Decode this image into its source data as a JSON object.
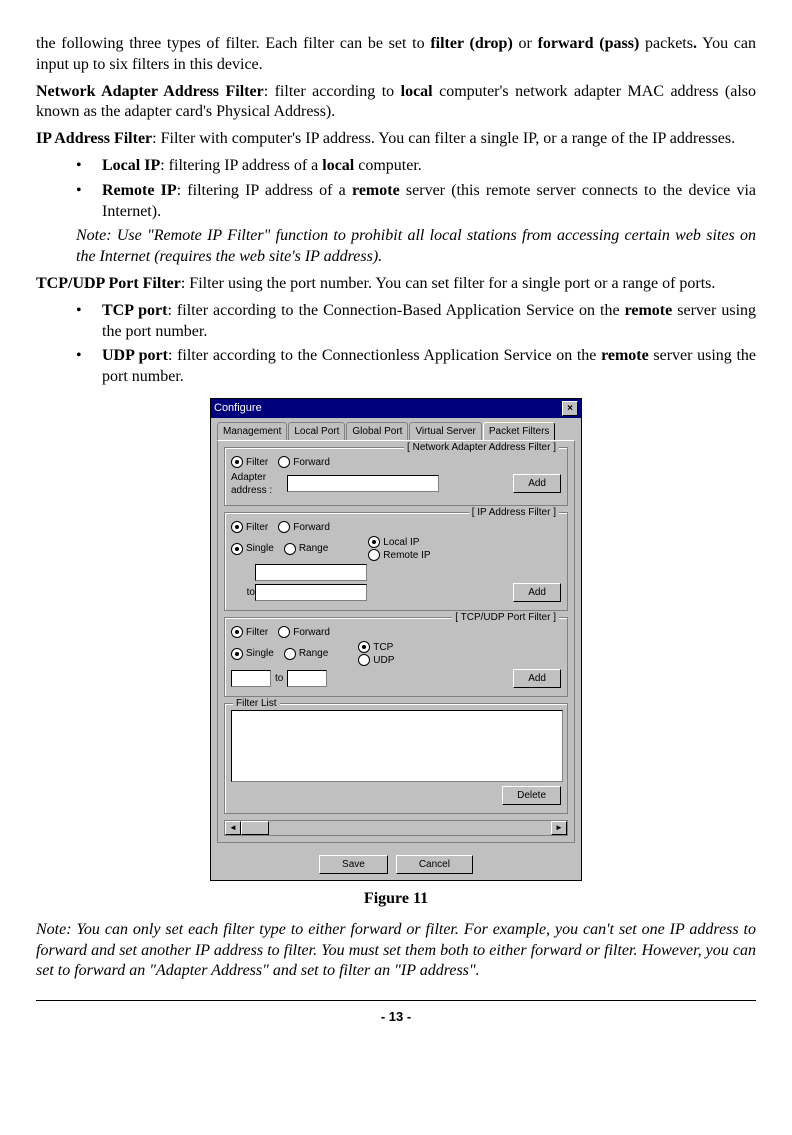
{
  "para_intro": "the following three types of filter. Each filter can be set to ",
  "intro_bold1": "filter (drop)",
  "intro_mid": " or ",
  "intro_bold2": "forward (pass)",
  "intro_end": " packets",
  "intro_tail": ".  You can input up to six filters in this device.",
  "naf_head": "Network Adapter Address Filter",
  "naf_body1": ": filter according to ",
  "naf_bold": "local",
  "naf_body2": " computer's network adapter MAC address (also known as the adapter card's Physical Address).",
  "ipf_head": "IP Address Filter",
  "ipf_body": ": Filter with computer's IP address. You can filter a single IP, or a range of the IP addresses.",
  "li1_head": "Local IP",
  "li1_body1": ": filtering IP address of a ",
  "li1_bold": "local",
  "li1_body2": " computer.",
  "li2_head": "Remote IP",
  "li2_body1": ": filtering IP address of a ",
  "li2_bold": "remote",
  "li2_body2": " server (this remote server connects to the device via Internet).",
  "note1": "Note: Use \"Remote IP Filter\" function to prohibit all local stations from accessing certain web sites on the Internet (requires the web site's IP address).",
  "tpf_head": "TCP/UDP Port Filter",
  "tpf_body": ": Filter using the port number. You can set filter for a single port or a range of ports.",
  "li3_head": "TCP port",
  "li3_body1": ": filter according to the Connection-Based Application Service on the ",
  "li3_bold": "remote",
  "li3_body2": " server using the port number.",
  "li4_head": "UDP port",
  "li4_body1": ": filter according to the Connectionless Application Service on the ",
  "li4_bold": "remote",
  "li4_body2": " server using the port number.",
  "figure_label": "Figure 11",
  "note2": "Note: You can only set each filter type to either forward or filter. For example, you can't set one IP address to forward and set another IP address to filter. You must set them both to either forward or filter. However, you can set to forward an \"Adapter Address\" and set to filter an \"IP address\".",
  "page_number": "- 13 -",
  "dialog": {
    "title": "Configure",
    "close": "×",
    "tabs": [
      "Management",
      "Local Port",
      "Global Port",
      "Virtual Server",
      "Packet Filters"
    ],
    "active_tab": "Packet Filters",
    "group1_label": "[ Network Adapter Address Filter ]",
    "group2_label": "[ IP Address Filter ]",
    "group3_label": "[ TCP/UDP Port Filter ]",
    "filter": "Filter",
    "forward": "Forward",
    "adapter_addr": "Adapter address :",
    "add": "Add",
    "single": "Single",
    "range": "Range",
    "local_ip": "Local IP",
    "remote_ip": "Remote IP",
    "to": "to",
    "tcp": "TCP",
    "udp": "UDP",
    "filter_list": "Filter List",
    "delete": "Delete",
    "save": "Save",
    "cancel": "Cancel"
  }
}
